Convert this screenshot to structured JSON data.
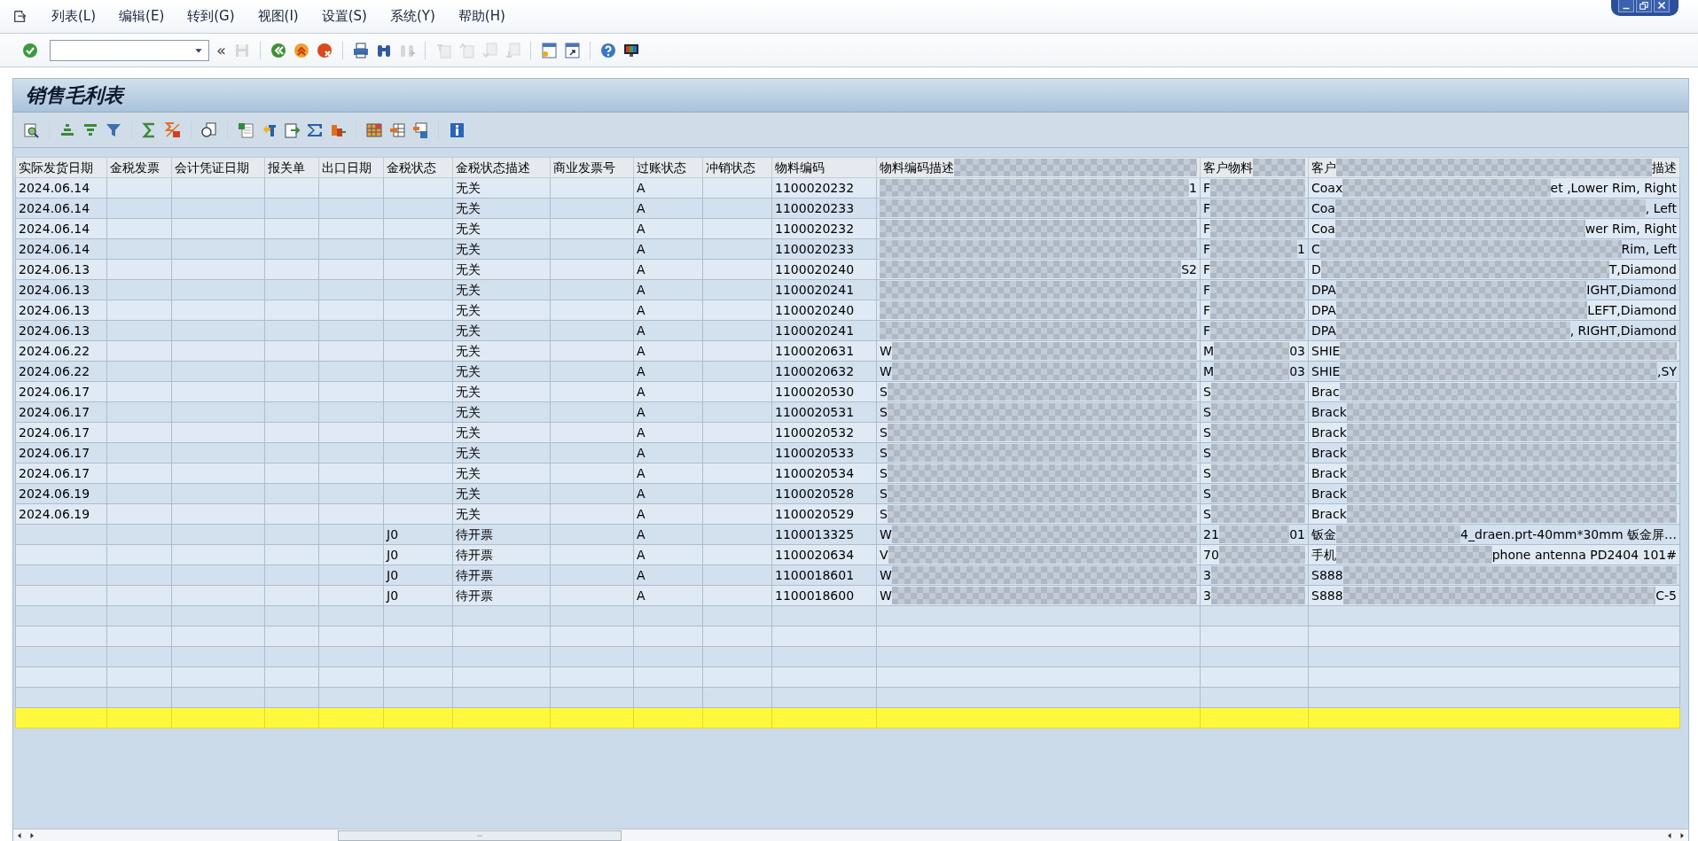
{
  "menu": [
    "列表(L)",
    "编辑(E)",
    "转到(G)",
    "视图(I)",
    "设置(S)",
    "系统(Y)",
    "帮助(H)"
  ],
  "toolbar": {
    "groups": [
      [
        {
          "kind": "enter",
          "disabled": false
        },
        {
          "kind": "command"
        },
        {
          "kind": "history",
          "label": "«"
        },
        {
          "kind": "save",
          "disabled": true
        }
      ],
      [
        {
          "kind": "back",
          "disabled": false
        },
        {
          "kind": "exit",
          "disabled": false
        },
        {
          "kind": "cancel",
          "disabled": false
        }
      ],
      [
        {
          "kind": "print",
          "disabled": false
        },
        {
          "kind": "find",
          "disabled": false
        },
        {
          "kind": "find_next",
          "disabled": true
        }
      ],
      [
        {
          "kind": "page_first",
          "disabled": true
        },
        {
          "kind": "page_prev",
          "disabled": true
        },
        {
          "kind": "page_next",
          "disabled": true
        },
        {
          "kind": "page_last",
          "disabled": true
        }
      ],
      [
        {
          "kind": "new_session",
          "disabled": false
        },
        {
          "kind": "shortcut",
          "disabled": false
        }
      ],
      [
        {
          "kind": "help",
          "disabled": false
        },
        {
          "kind": "layout",
          "disabled": false
        }
      ]
    ]
  },
  "title": "销售毛利表",
  "alv_toolbar": {
    "groups": [
      [
        {
          "kind": "details"
        }
      ],
      [
        {
          "kind": "sort_asc"
        },
        {
          "kind": "sort_desc"
        },
        {
          "kind": "filter"
        }
      ],
      [
        {
          "kind": "sum"
        },
        {
          "kind": "subtotal"
        }
      ],
      [
        {
          "kind": "view"
        }
      ],
      [
        {
          "kind": "export"
        },
        {
          "kind": "word"
        },
        {
          "kind": "local_file"
        },
        {
          "kind": "abc"
        },
        {
          "kind": "graphic"
        }
      ],
      [
        {
          "kind": "grid"
        },
        {
          "kind": "choose_layout"
        },
        {
          "kind": "save_layout"
        }
      ],
      [
        {
          "kind": "info"
        }
      ]
    ]
  },
  "table": {
    "columns": [
      {
        "label": "实际发货日期"
      },
      {
        "label": "金税发票"
      },
      {
        "label": "会计凭证日期"
      },
      {
        "label": "报关单"
      },
      {
        "label": "出口日期"
      },
      {
        "label": "金税状态"
      },
      {
        "label": "金税状态描述"
      },
      {
        "label": "商业发票号"
      },
      {
        "label": "过账状态"
      },
      {
        "label": "冲销状态"
      },
      {
        "label": "物料编码"
      },
      {
        "start": "物料编码描述"
      },
      {
        "start": "客户物料"
      },
      {
        "start": "客户",
        "end": "描述"
      }
    ],
    "rows": [
      {
        "cells": [
          "2024.06.14",
          "",
          "",
          "",
          "",
          "",
          "无关",
          "",
          "A",
          "",
          "1100020232",
          {
            "end": "1"
          },
          {
            "start": "F"
          },
          {
            "start": "Coax",
            "end": "et ,Lower Rim, Right"
          }
        ]
      },
      {
        "cells": [
          "2024.06.14",
          "",
          "",
          "",
          "",
          "",
          "无关",
          "",
          "A",
          "",
          "1100020233",
          {},
          {
            "start": "F"
          },
          {
            "start": "Coa",
            "end": ", Left"
          }
        ]
      },
      {
        "cells": [
          "2024.06.14",
          "",
          "",
          "",
          "",
          "",
          "无关",
          "",
          "A",
          "",
          "1100020232",
          {},
          {
            "start": "F"
          },
          {
            "start": "Coa",
            "end": "wer Rim, Right"
          }
        ]
      },
      {
        "cells": [
          "2024.06.14",
          "",
          "",
          "",
          "",
          "",
          "无关",
          "",
          "A",
          "",
          "1100020233",
          {},
          {
            "start": "F",
            "end": "1"
          },
          {
            "start": "C",
            "end": "Rim, Left"
          }
        ]
      },
      {
        "cells": [
          "2024.06.13",
          "",
          "",
          "",
          "",
          "",
          "无关",
          "",
          "A",
          "",
          "1100020240",
          {
            "end": "S2"
          },
          {
            "start": "F"
          },
          {
            "start": "D",
            "end": "T,Diamond"
          }
        ]
      },
      {
        "cells": [
          "2024.06.13",
          "",
          "",
          "",
          "",
          "",
          "无关",
          "",
          "A",
          "",
          "1100020241",
          {},
          {
            "start": "F"
          },
          {
            "start": "DPA",
            "end": "IGHT,Diamond"
          }
        ]
      },
      {
        "cells": [
          "2024.06.13",
          "",
          "",
          "",
          "",
          "",
          "无关",
          "",
          "A",
          "",
          "1100020240",
          {},
          {
            "start": "F"
          },
          {
            "start": "DPA",
            "end": "LEFT,Diamond"
          }
        ]
      },
      {
        "cells": [
          "2024.06.13",
          "",
          "",
          "",
          "",
          "",
          "无关",
          "",
          "A",
          "",
          "1100020241",
          {},
          {
            "start": "F"
          },
          {
            "start": "DPA",
            "end": ", RIGHT,Diamond"
          }
        ]
      },
      {
        "cells": [
          "2024.06.22",
          "",
          "",
          "",
          "",
          "",
          "无关",
          "",
          "A",
          "",
          "1100020631",
          {
            "start": "W"
          },
          {
            "start": "M",
            "end": "03"
          },
          {
            "start": "SHIE"
          }
        ]
      },
      {
        "cells": [
          "2024.06.22",
          "",
          "",
          "",
          "",
          "",
          "无关",
          "",
          "A",
          "",
          "1100020632",
          {
            "start": "W"
          },
          {
            "start": "M",
            "end": "03"
          },
          {
            "start": "SHIE",
            "end": ",SY"
          }
        ]
      },
      {
        "cells": [
          "2024.06.17",
          "",
          "",
          "",
          "",
          "",
          "无关",
          "",
          "A",
          "",
          "1100020530",
          {
            "start": "S"
          },
          {
            "start": "S"
          },
          {
            "start": "Brac"
          }
        ]
      },
      {
        "cells": [
          "2024.06.17",
          "",
          "",
          "",
          "",
          "",
          "无关",
          "",
          "A",
          "",
          "1100020531",
          {
            "start": "S"
          },
          {
            "start": "S"
          },
          {
            "start": "Brack"
          }
        ]
      },
      {
        "cells": [
          "2024.06.17",
          "",
          "",
          "",
          "",
          "",
          "无关",
          "",
          "A",
          "",
          "1100020532",
          {
            "start": "S"
          },
          {
            "start": "S"
          },
          {
            "start": "Brack"
          }
        ]
      },
      {
        "cells": [
          "2024.06.17",
          "",
          "",
          "",
          "",
          "",
          "无关",
          "",
          "A",
          "",
          "1100020533",
          {
            "start": "S"
          },
          {
            "start": "S"
          },
          {
            "start": "Brack"
          }
        ]
      },
      {
        "cells": [
          "2024.06.17",
          "",
          "",
          "",
          "",
          "",
          "无关",
          "",
          "A",
          "",
          "1100020534",
          {
            "start": "S"
          },
          {
            "start": "S"
          },
          {
            "start": "Brack"
          }
        ]
      },
      {
        "cells": [
          "2024.06.19",
          "",
          "",
          "",
          "",
          "",
          "无关",
          "",
          "A",
          "",
          "1100020528",
          {
            "start": "S"
          },
          {
            "start": "S"
          },
          {
            "start": "Brack"
          }
        ]
      },
      {
        "cells": [
          "2024.06.19",
          "",
          "",
          "",
          "",
          "",
          "无关",
          "",
          "A",
          "",
          "1100020529",
          {
            "start": "S"
          },
          {
            "start": "S"
          },
          {
            "start": "Brack"
          }
        ]
      },
      {
        "cells": [
          "",
          "",
          "",
          "",
          "",
          "J0",
          "待开票",
          "",
          "A",
          "",
          "1100013325",
          {
            "start": "W"
          },
          {
            "start": "21",
            "end": "01"
          },
          {
            "start": "钣金",
            "end": "4_draen.prt-40mm*30mm 钣金屏…"
          }
        ]
      },
      {
        "cells": [
          "",
          "",
          "",
          "",
          "",
          "J0",
          "待开票",
          "",
          "A",
          "",
          "1100020634",
          {
            "start": "V"
          },
          {
            "start": "70"
          },
          {
            "start": "手机",
            "end": "phone antenna PD2404 101#"
          }
        ]
      },
      {
        "cells": [
          "",
          "",
          "",
          "",
          "",
          "J0",
          "待开票",
          "",
          "A",
          "",
          "1100018601",
          {
            "start": "W"
          },
          {
            "start": "3"
          },
          {
            "start": "S888"
          }
        ]
      },
      {
        "cells": [
          "",
          "",
          "",
          "",
          "",
          "J0",
          "待开票",
          "",
          "A",
          "",
          "1100018600",
          {
            "start": "W"
          },
          {
            "start": "3"
          },
          {
            "start": "S888",
            "end": "C-5"
          }
        ]
      }
    ]
  }
}
